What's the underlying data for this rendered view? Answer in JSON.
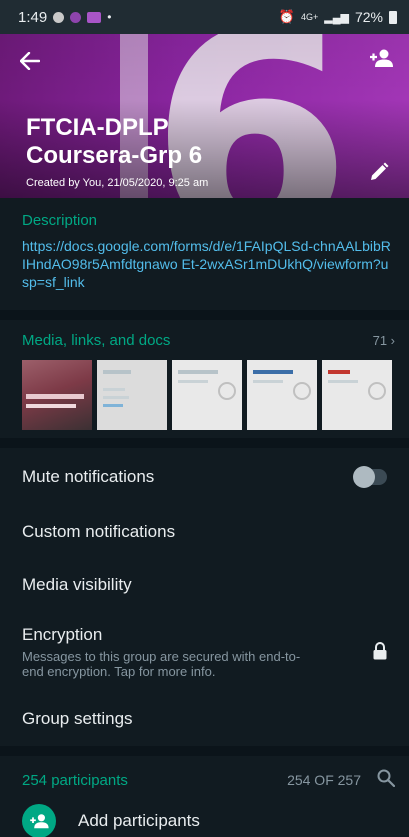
{
  "status_bar": {
    "time": "1:49",
    "network": "4G+",
    "battery": "72%"
  },
  "header": {
    "group_name_line1": "FTCIA-DPLP",
    "group_name_line2": "Coursera-Grp 6",
    "created_text": "Created by You, 21/05/2020, 9:25 am",
    "header_color": "#8a25a0"
  },
  "description": {
    "label": "Description",
    "text": "https://docs.google.com/forms/d/e/1FAIpQLSd-chnAALbibRIHndAO98r5Amfdtgnawo Et-2wxASr1mDUkhQ/viewform?usp=sf_link"
  },
  "media": {
    "label": "Media, links, and docs",
    "count": "71 ›"
  },
  "settings": {
    "mute": "Mute notifications",
    "custom": "Custom notifications",
    "visibility": "Media visibility",
    "encryption_title": "Encryption",
    "encryption_sub": "Messages to this group are secured with end-to-end encryption. Tap for more info.",
    "group_settings": "Group settings"
  },
  "participants": {
    "label": "254 participants",
    "count": "254 OF 257",
    "add_label": "Add participants"
  },
  "colors": {
    "accent": "#00a884",
    "link": "#53bdeb",
    "background": "#111b21"
  }
}
